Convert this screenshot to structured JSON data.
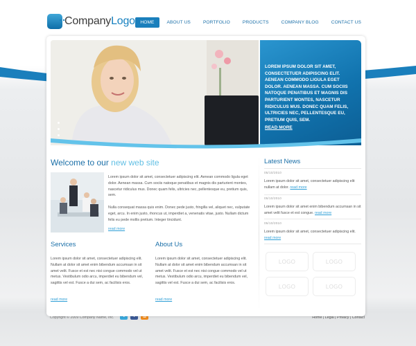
{
  "logo": {
    "text_a": "Company",
    "text_b": "Logo"
  },
  "nav": {
    "items": [
      {
        "label": "HOME"
      },
      {
        "label": "ABOUT US"
      },
      {
        "label": "PORTFOLIO"
      },
      {
        "label": "PRODUCTS"
      },
      {
        "label": "COMPANY BLOG"
      },
      {
        "label": "CONTACT US"
      }
    ]
  },
  "hero": {
    "text": "LOREM IPSUM DOLOR SIT AMET, CONSECTETUER ADIPISCING ELIT. AENEAN COMMODO LIGULA EGET DOLOR. AENEAN MASSA. CUM SOCIIS NATOQUE PENATIBUS ET MAGNIS DIS PARTURIENT MONTES, NASCETUR RIDICULUS MUS. DONEC QUAM FELIS, ULTRICIES NEC, PELLENTESQUE EU, PRETIUM QUIS, SEM.",
    "read_more": "READ MORE"
  },
  "welcome": {
    "title_a": "Welcome to our",
    "title_b": "new web site",
    "p1": "Lorem ipsum dolor sit amet, consectetuer adipiscing elit. Aenean commodo ligula eget dolor. Aenean massa. Cum sociis natoque penatibus et magnis dis parturient montes, nascetur ridiculus mus. Donec quam felis, ultricies nec, pellentesque eu, pretium quis, sem.",
    "p2": "Nulla consequat massa quis enim. Donec pede justo, fringilla vel, aliquet nec, vulputate eget, arcu. In enim justo, rhoncus ut, imperdiet a, venenatis vitae, justo. Nullam dictum felis eu pede mollis pretium. Integer tincidunt.",
    "read_more": "read more"
  },
  "services": {
    "title": "Services",
    "text": "Lorem ipsum dolor sit amet, consectetuer adipiscing elit. Nullam at dolor sit amet enim bibendum accumsan in sit amet velit. Fusce et est nec nisi congue commodo vel ut metus. Vestibulum odio arcu, imperdiet eu bibendum vel, sagittis vel est. Fusce a dui sem, ac facilisis eros.",
    "read_more": "read more"
  },
  "about": {
    "title": "About Us",
    "text": "Lorem ipsum dolor sit amet, consectetuer adipiscing elit. Nullam at dolor sit amet enim bibendum accumsan in sit amet velit. Fusce et est nec nisi congue commodo vel ut metus. Vestibulum odio arcu, imperdiet eu bibendum vel, sagittis vel est. Fusce a dui sem, ac facilisis eros.",
    "read_more": "read more"
  },
  "news": {
    "title": "Latest News",
    "items": [
      {
        "date": "05/10/2010",
        "text": "Lorem ipsum dolor sit amet, consectetuer adipiscing elit nullam at dolor.",
        "read_more": "read more"
      },
      {
        "date": "05/10/2010",
        "text": "Lorem ipsum dolor sit amet enim bibendum accumsan in sit amet velit fusce et est congue.",
        "read_more": "read more"
      },
      {
        "date": "05/10/2010",
        "text": "Lorem ipsum dolor sit amet, consectetuer adipiscing elit.",
        "read_more": "read more"
      }
    ]
  },
  "partner_logos": [
    "LOGO",
    "LOGO",
    "LOGO",
    "LOGO"
  ],
  "footer": {
    "copyright": "Copyright © 2009 Company Name, Inc.",
    "social": {
      "twitter": "t",
      "facebook": "f",
      "rss": "≋"
    },
    "links": [
      "Home",
      "Legal",
      "Privacy",
      "Contact"
    ],
    "separator": " | "
  },
  "colors": {
    "brand_blue": "#1a7fbc",
    "light_blue": "#61bfe4",
    "link": "#2d9ed6"
  }
}
